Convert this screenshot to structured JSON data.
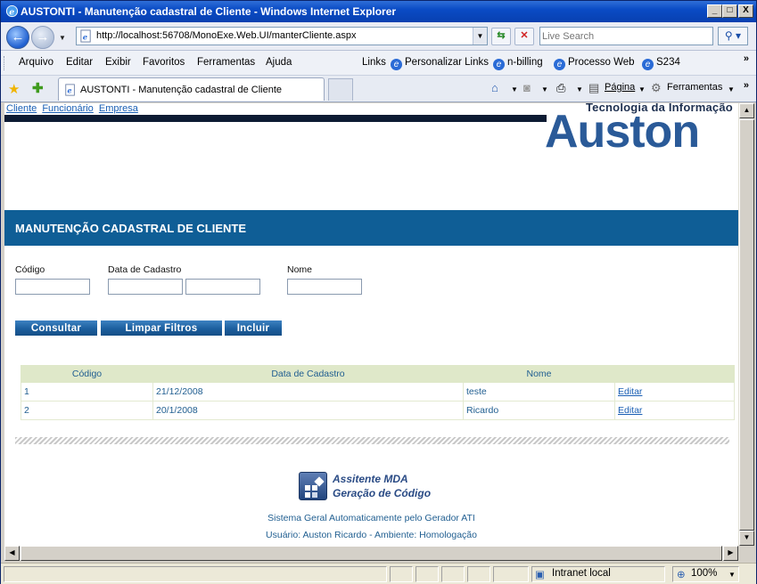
{
  "window": {
    "title": "AUSTONTI - Manutenção cadastral de Cliente - Windows Internet Explorer",
    "min": "_",
    "max": "□",
    "close": "X"
  },
  "address": {
    "url": "http://localhost:56708/MonoExe.Web.UI/manterCliente.aspx",
    "search_placeholder": "Live Search"
  },
  "menu": [
    "Arquivo",
    "Editar",
    "Exibir",
    "Favoritos",
    "Ferramentas",
    "Ajuda"
  ],
  "links": {
    "label": "Links",
    "items": [
      "Personalizar Links",
      "n-billing",
      "Processo Web",
      "S234"
    ]
  },
  "tab": {
    "label": "AUSTONTI - Manutenção cadastral de Cliente"
  },
  "commandbar": {
    "page": "Página",
    "tools": "Ferramentas"
  },
  "page": {
    "toplinks": [
      "Cliente",
      "Funcionário",
      "Empresa"
    ],
    "logo_tagline": "Tecnologia da Informação",
    "logo_word": "Auston",
    "banner_title": "MANUTENÇÃO CADASTRAL DE CLIENTE",
    "filters": {
      "codigo_label": "Código",
      "data_label": "Data de Cadastro",
      "nome_label": "Nome",
      "codigo_value": "",
      "data_from_value": "",
      "data_to_value": "",
      "nome_value": ""
    },
    "buttons": {
      "consultar": "Consultar",
      "limpar": "Limpar Filtros",
      "incluir": "Incluir"
    },
    "grid": {
      "headers": [
        "Código",
        "Data de Cadastro",
        "Nome",
        ""
      ],
      "rows": [
        {
          "codigo": "1",
          "data": "21/12/2008",
          "nome": "teste",
          "acao": "Editar"
        },
        {
          "codigo": "2",
          "data": "20/1/2008",
          "nome": "Ricardo",
          "acao": "Editar"
        }
      ]
    },
    "mda": {
      "line1": "Assitente MDA",
      "line2": "Geração de Código"
    },
    "footer": {
      "line1": "Sistema Geral Automaticamente pelo Gerador ATI",
      "line2": "Usuário: Auston Ricardo - Ambiente: Homologação"
    }
  },
  "status": {
    "zone": "Intranet local",
    "zoom": "100%"
  }
}
